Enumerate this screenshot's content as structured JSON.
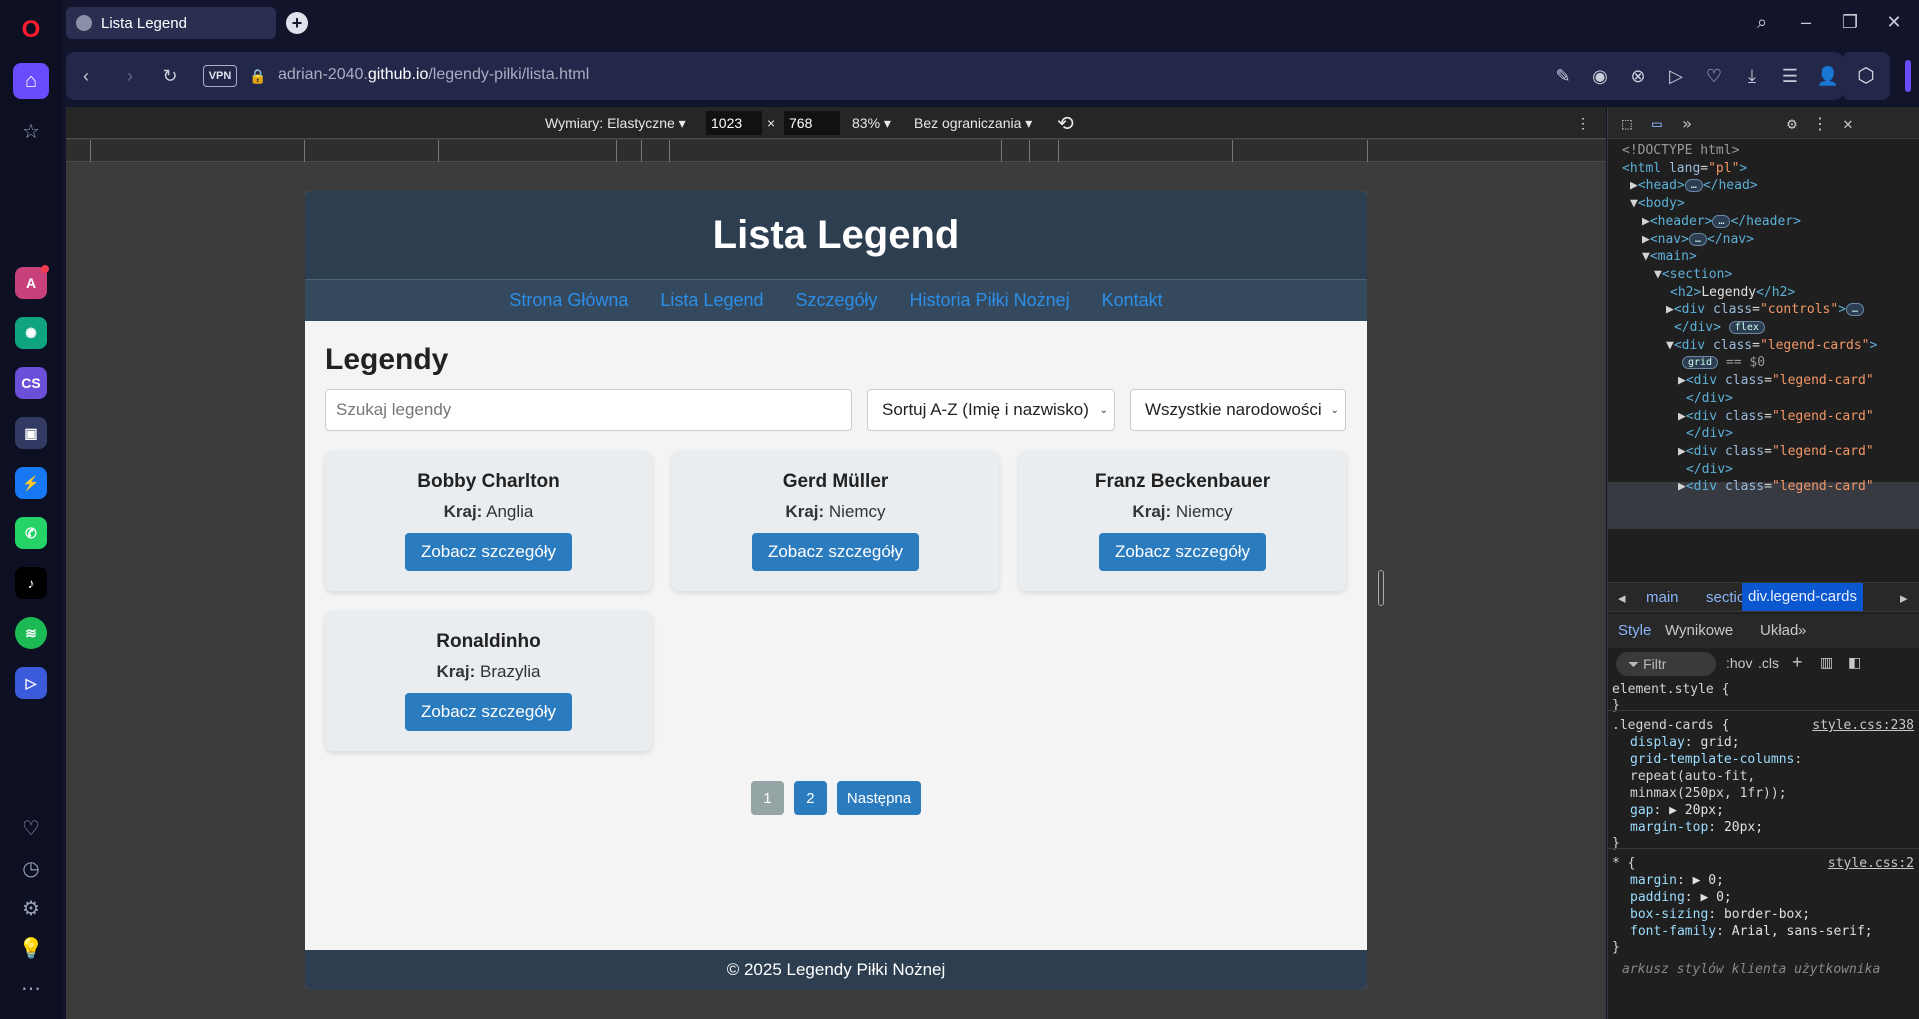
{
  "browser": {
    "tab_title": "Lista Legend",
    "url_prefix": "adrian-2040.",
    "url_domain": "github.io",
    "url_path": "/legendy-pilki/lista.html",
    "vpn_label": "VPN",
    "new_tab_label": "+",
    "window_controls": [
      "search-icon",
      "minimize-icon",
      "restore-icon",
      "close-icon"
    ],
    "toolbar_icons": [
      "back-icon",
      "forward-icon",
      "reload-icon",
      "lock-icon",
      "edit-icon",
      "camera-icon",
      "shield-icon",
      "play-icon",
      "heart-icon",
      "download-icon",
      "menu-icon",
      "profile-icon",
      "cube-icon"
    ]
  },
  "sidebar": {
    "items": [
      "opera-logo",
      "home-icon",
      "star-icon",
      "aria-app",
      "chatgpt-app",
      "cs-app",
      "bag-app",
      "messenger-app",
      "whatsapp-app",
      "tiktok-app",
      "spotify-app",
      "player-app",
      "heart-icon",
      "history-icon",
      "settings-icon",
      "bulb-icon",
      "more-icon"
    ],
    "cs_label": "CS"
  },
  "devbar": {
    "dimensions_label": "Wymiary: Elastyczne",
    "width": "1023",
    "height": "768",
    "times": "×",
    "zoom": "83%",
    "throttling": "Bez ograniczania"
  },
  "site": {
    "header_title": "Lista Legend",
    "nav": [
      "Strona Główna",
      "Lista Legend",
      "Szczegóły",
      "Historia Piłki Nożnej",
      "Kontakt"
    ],
    "section_heading": "Legendy",
    "search_placeholder": "Szukaj legendy",
    "sort_value": "Sortuj A-Z (Imię i nazwisko)",
    "nationality_value": "Wszystkie narodowości",
    "country_label": "Kraj:",
    "details_button": "Zobacz szczegóły",
    "cards": [
      {
        "name": "Bobby Charlton",
        "country": "Anglia"
      },
      {
        "name": "Gerd Müller",
        "country": "Niemcy"
      },
      {
        "name": "Franz Beckenbauer",
        "country": "Niemcy"
      },
      {
        "name": "Ronaldinho",
        "country": "Brazylia"
      }
    ],
    "pagination": {
      "pages": [
        "1",
        "2"
      ],
      "current": "1",
      "next_label": "Następna"
    },
    "footer": "© 2025 Legendy Piłki Nożnej"
  },
  "devtools": {
    "dom_lines": [
      {
        "html": "<span class='cm'>&lt;!DOCTYPE html&gt;</span>"
      },
      {
        "html": "<span class='tag'>&lt;html</span> <span class='attr'>lang</span>=<span class='val'>\"pl\"</span><span class='tag'>&gt;</span>"
      },
      {
        "html": "▶<span class='tag'>&lt;head&gt;</span><span class='pill'>…</span><span class='tag'>&lt;/head&gt;</span>"
      },
      {
        "html": "▼<span class='tag'>&lt;body&gt;</span>"
      },
      {
        "html": "▶<span class='tag'>&lt;header&gt;</span><span class='pill'>…</span><span class='tag'>&lt;/header&gt;</span>"
      },
      {
        "html": "▶<span class='tag'>&lt;nav&gt;</span><span class='pill'>…</span><span class='tag'>&lt;/nav&gt;</span>"
      },
      {
        "html": "▼<span class='tag'>&lt;main&gt;</span>"
      },
      {
        "html": "▼<span class='tag'>&lt;section&gt;</span>"
      },
      {
        "html": "<span class='tag'>&lt;h2&gt;</span><span class='txt'>Legendy</span><span class='tag'>&lt;/h2&gt;</span>"
      },
      {
        "html": "▶<span class='tag'>&lt;div</span> <span class='attr'>class</span>=<span class='val'>\"controls\"</span><span class='tag'>&gt;</span><span class='pill'>…</span>"
      },
      {
        "html": "<span class='tag'>&lt;/div&gt;</span> <span class='pill'>flex</span>"
      },
      {
        "html": "▼<span class='tag'>&lt;div</span> <span class='attr'>class</span>=<span class='val'>\"legend-cards\"</span><span class='tag'>&gt;</span>"
      },
      {
        "html": "<span class='pill'>grid</span> <span class='cm'>== $0</span>"
      },
      {
        "html": "▶<span class='tag'>&lt;div</span> <span class='attr'>class</span>=<span class='val'>\"legend-card\"</span>"
      },
      {
        "html": "<span class='tag'>&lt;/div&gt;</span>"
      },
      {
        "html": "▶<span class='tag'>&lt;div</span> <span class='attr'>class</span>=<span class='val'>\"legend-card\"</span>"
      },
      {
        "html": "<span class='tag'>&lt;/div&gt;</span>"
      },
      {
        "html": "▶<span class='tag'>&lt;div</span> <span class='attr'>class</span>=<span class='val'>\"legend-card\"</span>"
      },
      {
        "html": "<span class='tag'>&lt;/div&gt;</span>"
      },
      {
        "html": "▶<span class='tag'>&lt;div</span> <span class='attr'>class</span>=<span class='val'>\"legend-card\"</span>"
      }
    ],
    "breadcrumbs": [
      "main",
      "section",
      "div.legend-cards"
    ],
    "style_tabs": [
      "Style",
      "Wynikowe",
      "Układ"
    ],
    "filter_placeholder": "Filtr",
    "hov_label": ":hov",
    "cls_label": ".cls",
    "css_rules": [
      {
        "text": "element.style {"
      },
      {
        "text": "}"
      },
      {
        "text": ".legend-cards {",
        "source": "style.css:238"
      },
      {
        "prop": "display",
        "value": "grid;"
      },
      {
        "prop": "grid-template-columns",
        "value": ""
      },
      {
        "text": "    repeat(auto-fit,"
      },
      {
        "text": "    minmax(250px, 1fr));"
      },
      {
        "prop": "gap",
        "value": "▶ 20px;"
      },
      {
        "prop": "margin-top",
        "value": "20px;"
      },
      {
        "text": "}"
      },
      {
        "text": "* {",
        "source": "style.css:2"
      },
      {
        "prop": "margin",
        "value": "▶ 0;"
      },
      {
        "prop": "padding",
        "value": "▶ 0;"
      },
      {
        "prop": "box-sizing",
        "value": "border-box;"
      },
      {
        "prop": "font-family",
        "value": "Arial, sans-serif;"
      },
      {
        "text": "}"
      },
      {
        "text": "arkusz stylów klienta użytkownika"
      }
    ]
  }
}
